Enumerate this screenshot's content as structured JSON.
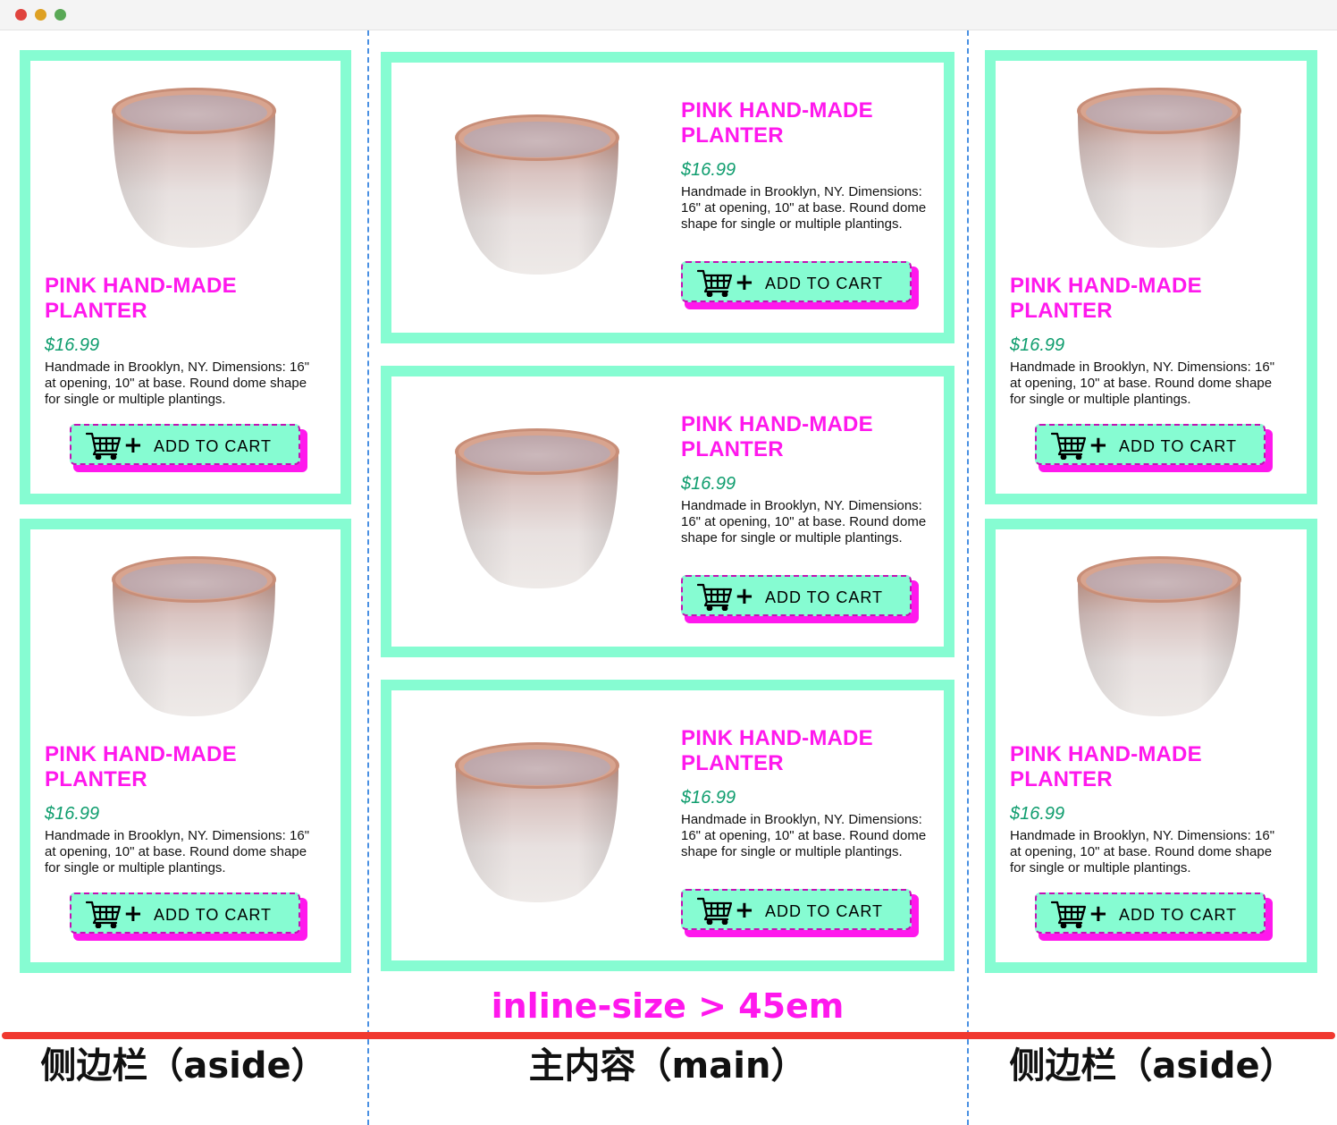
{
  "window": {
    "controls": [
      "close",
      "minimize",
      "zoom"
    ]
  },
  "product": {
    "title": "PINK HAND-MADE PLANTER",
    "price": "$16.99",
    "description": "Handmade in Brooklyn, NY. Dimensions: 16\" at opening, 10\" at base. Round dome shape for single or multiple plantings.",
    "button_label": "ADD TO CART",
    "button_icon": "cart-plus-icon",
    "image_icon": "planter-pot-image"
  },
  "annotation": "inline-size > 45em",
  "regions": {
    "left": "侧边栏（aside）",
    "main": "主内容（main）",
    "right": "侧边栏（aside）"
  },
  "colors": {
    "card_border": "#86fcd2",
    "title": "#ff18ed",
    "price": "#0f9d6e",
    "button_bg": "#86fcd2",
    "button_shadow": "#ff18ed",
    "divider": "#4a90e2",
    "baseline": "#f0382f"
  }
}
